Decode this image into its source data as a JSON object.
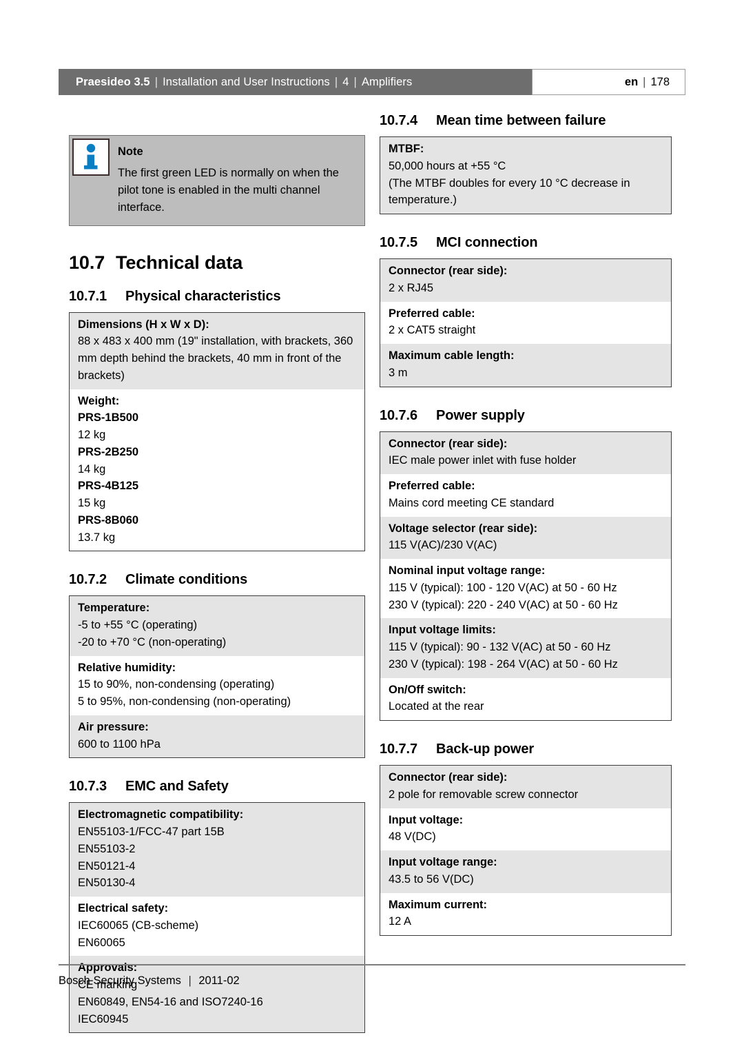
{
  "header": {
    "product": "Praesideo 3.5",
    "doc_title": "Installation and User Instructions",
    "chapter": "4",
    "chapter_title": "Amplifiers",
    "separator": "|",
    "language": "en",
    "page_number": "178"
  },
  "note": {
    "icon": "info-icon",
    "title": "Note",
    "text": "The first green LED is normally on when the pilot tone is enabled in the multi channel interface."
  },
  "section": {
    "number": "10.7",
    "title": "Technical data"
  },
  "subsections": {
    "physical": {
      "number": "10.7.1",
      "title": "Physical characteristics"
    },
    "climate": {
      "number": "10.7.2",
      "title": "Climate conditions"
    },
    "emc": {
      "number": "10.7.3",
      "title": "EMC and Safety"
    },
    "mtbf": {
      "number": "10.7.4",
      "title": "Mean time between failure"
    },
    "mci": {
      "number": "10.7.5",
      "title": "MCI connection"
    },
    "power": {
      "number": "10.7.6",
      "title": "Power supply"
    },
    "backup": {
      "number": "10.7.7",
      "title": "Back-up power"
    }
  },
  "tables": {
    "physical": [
      {
        "label": "Dimensions (H x W x D):",
        "values": [
          "88 x 483 x 400 mm (19\" installation, with brackets, 360 mm depth behind the brackets, 40 mm in front of the brackets)"
        ]
      },
      {
        "label": "Weight:",
        "values": [
          "PRS-1B500",
          "12 kg",
          "PRS-2B250",
          "14 kg",
          "PRS-4B125",
          "15 kg",
          "PRS-8B060",
          "13.7 kg"
        ],
        "bold_values": [
          true,
          false,
          true,
          false,
          true,
          false,
          true,
          false
        ]
      }
    ],
    "climate": [
      {
        "label": "Temperature:",
        "values": [
          "-5 to +55 °C (operating)",
          "-20 to +70 °C (non-operating)"
        ]
      },
      {
        "label": "Relative humidity:",
        "values": [
          "15 to 90%, non-condensing (operating)",
          "5 to 95%, non-condensing (non-operating)"
        ]
      },
      {
        "label": "Air pressure:",
        "values": [
          "600 to 1100 hPa"
        ]
      }
    ],
    "emc": [
      {
        "label": "Electromagnetic compatibility:",
        "values": [
          "EN55103-1/FCC-47 part 15B",
          "EN55103-2",
          "EN50121-4",
          "EN50130-4"
        ]
      },
      {
        "label": "Electrical safety:",
        "values": [
          "IEC60065 (CB-scheme)",
          "EN60065"
        ]
      },
      {
        "label": "Approvals:",
        "values": [
          "CE marking",
          "EN60849, EN54-16 and ISO7240-16",
          "IEC60945"
        ]
      }
    ],
    "mtbf": [
      {
        "label": "MTBF:",
        "values": [
          "50,000 hours at +55 °C",
          "(The MTBF doubles for every 10 °C decrease in temperature.)"
        ]
      }
    ],
    "mci": [
      {
        "label": "Connector (rear side):",
        "values": [
          "2 x RJ45"
        ]
      },
      {
        "label": "Preferred cable:",
        "values": [
          "2 x CAT5 straight"
        ]
      },
      {
        "label": "Maximum cable length:",
        "values": [
          "3 m"
        ]
      }
    ],
    "power": [
      {
        "label": "Connector (rear side):",
        "values": [
          "IEC male power inlet with fuse holder"
        ]
      },
      {
        "label": "Preferred cable:",
        "values": [
          "Mains cord meeting CE standard"
        ]
      },
      {
        "label": "Voltage selector (rear side):",
        "values": [
          "115 V(AC)/230 V(AC)"
        ]
      },
      {
        "label": "Nominal input voltage range:",
        "values": [
          "115 V (typical): 100 - 120 V(AC) at 50 - 60 Hz",
          "230 V (typical): 220 - 240 V(AC) at 50 - 60 Hz"
        ]
      },
      {
        "label": "Input voltage limits:",
        "values": [
          "115 V (typical): 90 - 132 V(AC) at 50 - 60 Hz",
          "230 V (typical): 198 - 264 V(AC) at 50 - 60 Hz"
        ]
      },
      {
        "label": "On/Off switch:",
        "values": [
          "Located at the rear"
        ]
      }
    ],
    "backup": [
      {
        "label": "Connector (rear side):",
        "values": [
          "2 pole for removable screw connector"
        ]
      },
      {
        "label": "Input voltage:",
        "values": [
          "48 V(DC)"
        ]
      },
      {
        "label": "Input voltage range:",
        "values": [
          "43.5 to 56 V(DC)"
        ]
      },
      {
        "label": "Maximum current:",
        "values": [
          "12 A"
        ]
      }
    ]
  },
  "footer": {
    "company": "Bosch Security Systems",
    "separator": "|",
    "date": "2011-02"
  },
  "colors": {
    "header_bar": "#6e6e6e",
    "note_bg": "#bdbdbd",
    "row_shade": "#e4e4e4",
    "icon_blue": "#0a7ec2"
  }
}
